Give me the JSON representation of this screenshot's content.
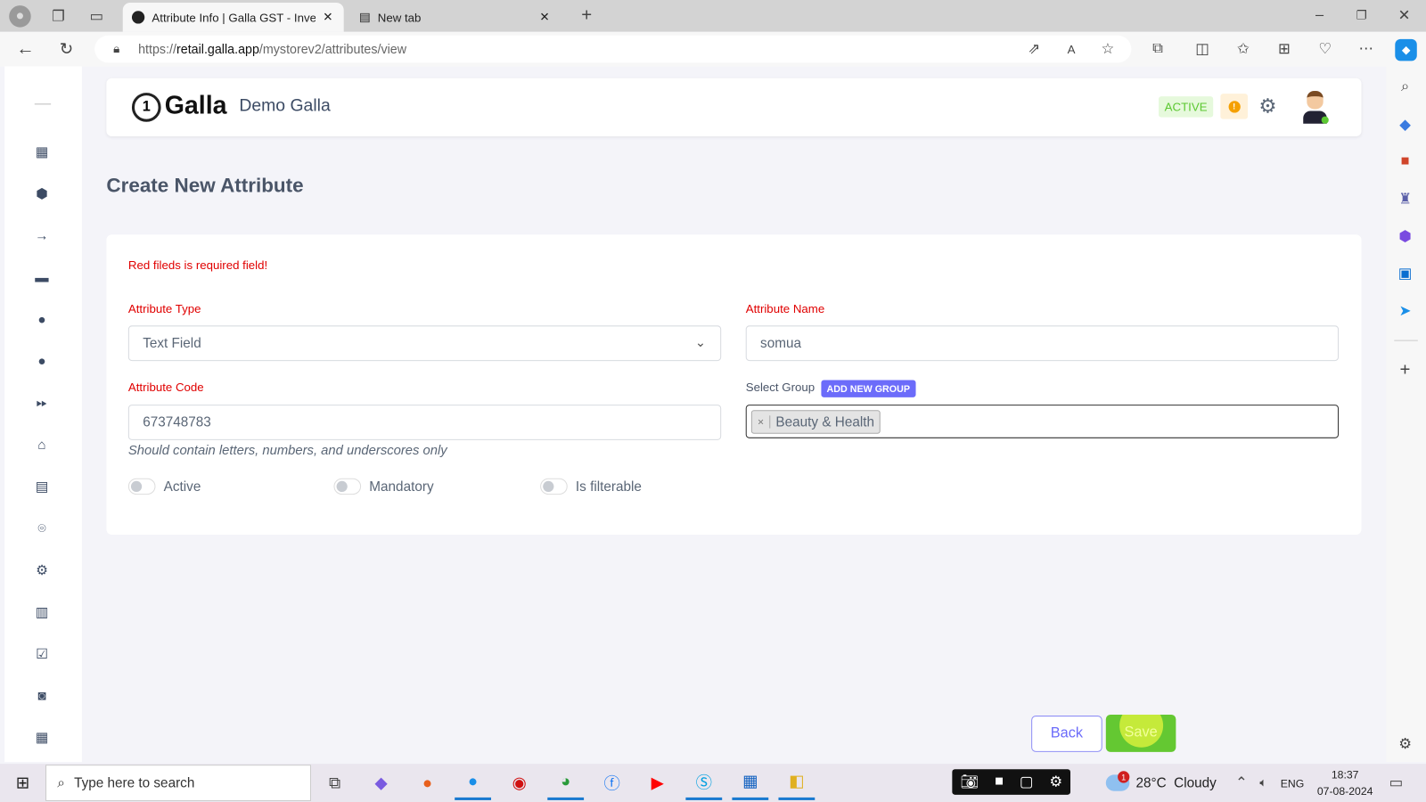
{
  "browser": {
    "tabs": [
      {
        "title": "Attribute Info | Galla GST - Invent",
        "active": true
      },
      {
        "title": "New tab",
        "active": false
      }
    ],
    "url_prefix": "https://",
    "url_domain": "retail.galla.app",
    "url_path": "/mystorev2/attributes/view"
  },
  "header": {
    "logo_text": "Galla",
    "store_name": "Demo Galla",
    "status_badge": "ACTIVE",
    "colors": {
      "badge_bg": "#e6f9dc",
      "badge_text": "#5cc832",
      "alert": "#f5a000"
    }
  },
  "page": {
    "title": "Create New Attribute"
  },
  "form": {
    "required_note": "Red fileds is required field!",
    "attribute_type": {
      "label": "Attribute Type",
      "value": "Text Field"
    },
    "attribute_name": {
      "label": "Attribute Name",
      "value": "somua"
    },
    "attribute_code": {
      "label": "Attribute Code",
      "value": "673748783",
      "hint": "Should contain letters, numbers, and underscores only"
    },
    "select_group": {
      "label": "Select Group",
      "add_button": "ADD NEW GROUP",
      "tags": [
        "Beauty & Health"
      ]
    },
    "toggles": [
      {
        "label": "Active",
        "on": false
      },
      {
        "label": "Mandatory",
        "on": false
      },
      {
        "label": "Is filterable",
        "on": false
      }
    ],
    "back_label": "Back",
    "save_label": "Save"
  },
  "sidebar": {
    "icons": [
      "menu-icon",
      "dashboard-icon",
      "box-icon",
      "arrow-right-icon",
      "ticket-icon",
      "user-icon",
      "user-circle-icon",
      "forward-icon",
      "basket-icon",
      "contacts-icon",
      "location-pin-icon",
      "gear-icon",
      "report-icon",
      "checkbox-icon",
      "camera-icon",
      "calendar-icon"
    ]
  },
  "taskbar": {
    "search_placeholder": "Type here to search",
    "weather": "28°C  Cloudy",
    "language": "ENG",
    "time": "18:37",
    "date": "07-08-2024",
    "weather_badge": "1"
  }
}
